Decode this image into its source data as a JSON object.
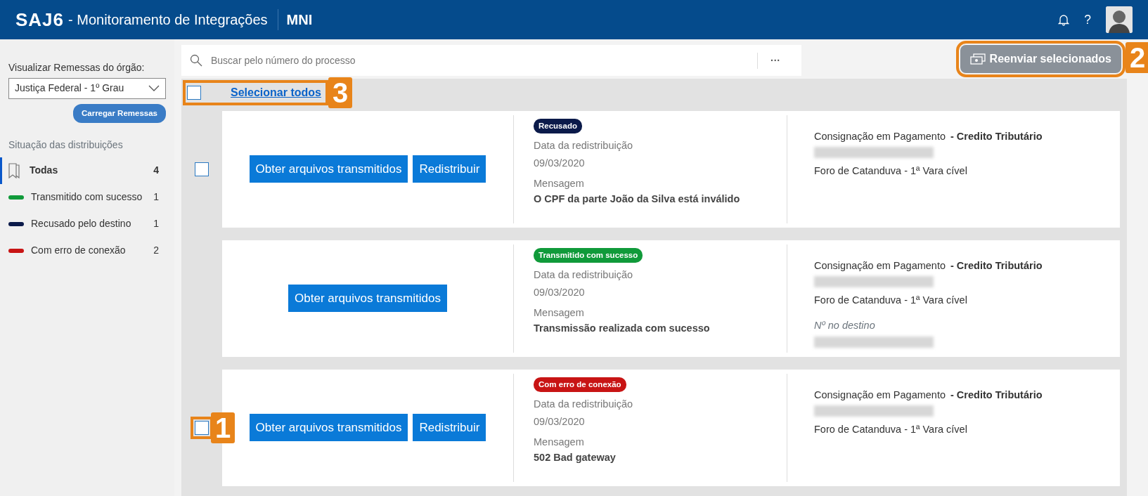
{
  "header": {
    "logo": "SAJ6",
    "title": "- Monitoramento de Integrações",
    "module": "MNI",
    "help": "?"
  },
  "sidebar": {
    "org_label": "Visualizar Remessas do órgão:",
    "org_select": "Justiça Federal - 1º Grau",
    "load_button": "Carregar Remessas",
    "status_heading": "Situação das distribuições",
    "items": [
      {
        "kind": "all",
        "label": "Todas",
        "count": "4",
        "selected": true
      },
      {
        "kind": "status",
        "label": "Transmitido com sucesso",
        "count": "1",
        "color": "#109a3a",
        "selected": false
      },
      {
        "kind": "status",
        "label": "Recusado pelo destino",
        "count": "1",
        "color": "#0b1a4a",
        "selected": false
      },
      {
        "kind": "status",
        "label": "Com erro de conexão",
        "count": "2",
        "color": "#c81414",
        "selected": false
      }
    ]
  },
  "search": {
    "placeholder": "Buscar pelo número do processo",
    "more": "···"
  },
  "resend_button": {
    "label": "Reenviar selecionados",
    "disabled": true,
    "callout": "2"
  },
  "select_all": {
    "label": "Selecionar todos",
    "checked": false,
    "callout": "3"
  },
  "cards": [
    {
      "selectable": true,
      "checked": false,
      "buttons": [
        "Obter arquivos transmitidos",
        "Redistribuir"
      ],
      "status": "Recusado",
      "color": "#0b1a4a",
      "date_label": "Data da redistribuição",
      "date": "09/03/2020",
      "message_label": "Mensagem",
      "message": "O CPF da parte João da Silva está inválido",
      "class_name": "Consignação em Pagamento",
      "subject": "- Credito Tributário",
      "process_redacted": true,
      "court": "Foro de Catanduva - 1ª Vara cível"
    },
    {
      "selectable": false,
      "buttons": [
        "Obter arquivos transmitidos"
      ],
      "status": "Transmitido com sucesso",
      "color": "#109a3a",
      "date_label": "Data da redistribuição",
      "date": "09/03/2020",
      "message_label": "Mensagem",
      "message": "Transmissão realizada com sucesso",
      "class_name": "Consignação em Pagamento",
      "subject": "- Credito Tributário",
      "process_redacted": true,
      "court": "Foro de Catanduva - 1ª Vara cível",
      "destination_label": "Nº no destino",
      "destination_redacted": true
    },
    {
      "selectable": true,
      "checked": false,
      "callout": "1",
      "buttons": [
        "Obter arquivos transmitidos",
        "Redistribuir"
      ],
      "status": "Com erro de conexão",
      "color": "#c81414",
      "date_label": "Data da redistribuição",
      "date": "09/03/2020",
      "message_label": "Mensagem",
      "message": "502 Bad gateway",
      "class_name": "Consignação em Pagamento",
      "subject": "- Credito Tributário",
      "process_redacted": true,
      "court": "Foro de Catanduva - 1ª Vara cível"
    }
  ]
}
